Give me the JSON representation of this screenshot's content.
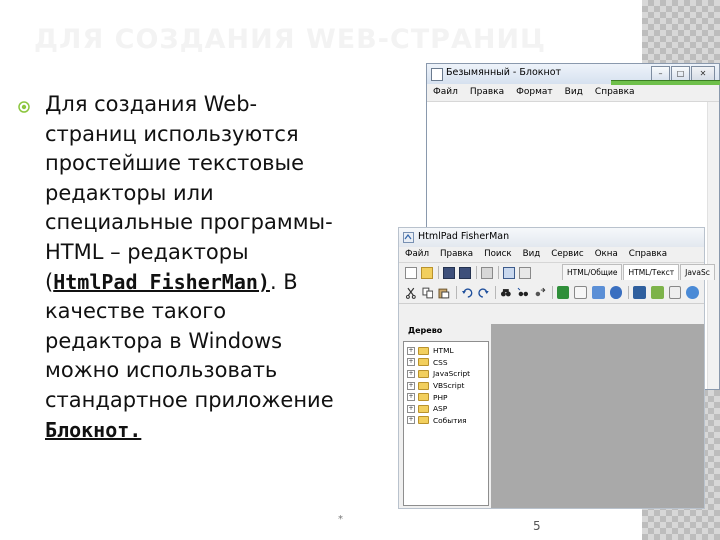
{
  "slide": {
    "title": "ДЛЯ СОЗДАНИЯ WEB-СТРАНИЦ",
    "body_intro": "Для создания Web-страниц используются простейшие текстовые редакторы или специальные программы-HTML – редакторы (",
    "body_link1": "HtmlPad FisherMan)",
    "body_mid": ". В качестве такого редактора в Windows можно использовать стандартное приложение ",
    "body_link2": "Блокнот.",
    "footer_mark": "*",
    "page_number": "5"
  },
  "notepad": {
    "title": "Безымянный - Блокнот",
    "menu": [
      "Файл",
      "Правка",
      "Формат",
      "Вид",
      "Справка"
    ]
  },
  "htmlpad": {
    "title": "HtmlPad FisherMan",
    "menu": [
      "Файл",
      "Правка",
      "Поиск",
      "Вид",
      "Сервис",
      "Окна",
      "Справка"
    ],
    "tabs": [
      "HTML/Общие",
      "HTML/Текст",
      "JavaSc"
    ],
    "tree_header": "Дерево",
    "tree_items": [
      "HTML",
      "CSS",
      "JavaScript",
      "VBScript",
      "PHP",
      "ASP",
      "События"
    ]
  },
  "colors": {
    "title_text": "#f3f3f3",
    "bullet": "#8cc63f",
    "notepad_green_bar": "#6fc04b",
    "folder": "#f2cf5d",
    "workspace": "#a9a9a9"
  }
}
